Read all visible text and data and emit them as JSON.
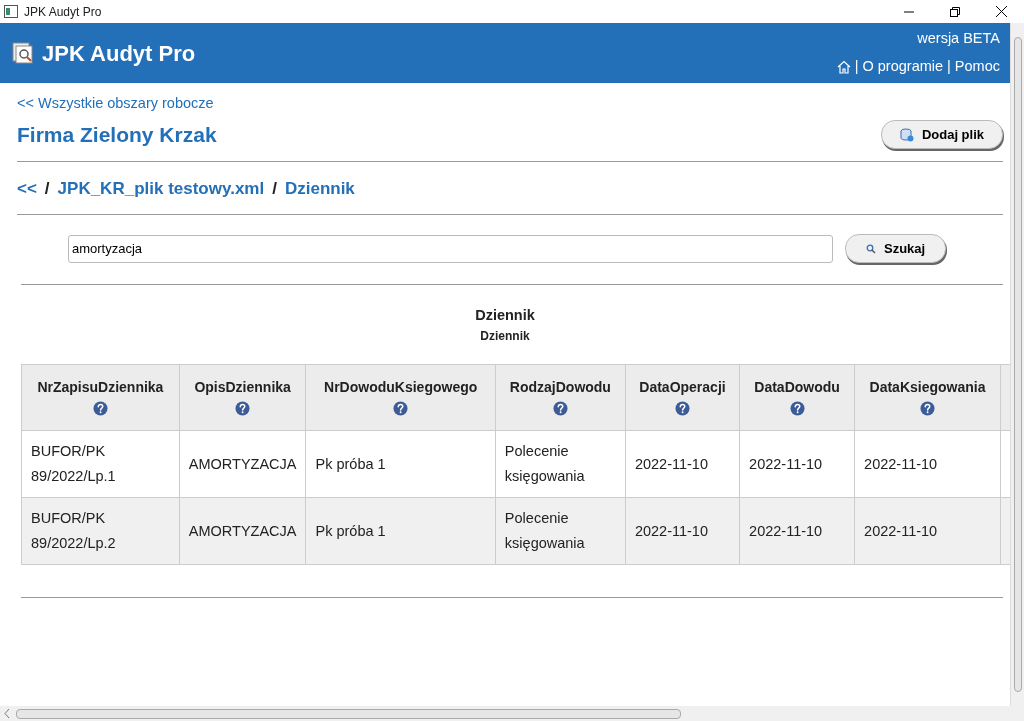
{
  "window": {
    "title": "JPK Audyt Pro"
  },
  "header": {
    "title": "JPK Audyt Pro",
    "version": "wersja BETA",
    "links": [
      "|",
      "O programie",
      "|",
      "Pomoc"
    ]
  },
  "back_link": "<< Wszystkie obszary robocze",
  "company": "Firma Zielony Krzak",
  "add_button": "Dodaj plik",
  "breadcrumb": [
    {
      "text": "<<",
      "kind": "link"
    },
    {
      "text": "/",
      "kind": "sep"
    },
    {
      "text": "JPK_KR_plik testowy.xml",
      "kind": "link"
    },
    {
      "text": "/",
      "kind": "sep"
    },
    {
      "text": "Dziennik",
      "kind": "link"
    }
  ],
  "search": {
    "value": "amortyzacja",
    "button": "Szukaj"
  },
  "table": {
    "title": "Dziennik",
    "subtitle": "Dziennik",
    "columns": [
      "NrZapisuDziennika",
      "OpisDziennika",
      "NrDowoduKsiegowego",
      "RodzajDowodu",
      "DataOperacji",
      "DataDowodu",
      "DataKsiegowania"
    ],
    "rows": [
      [
        "BUFOR/PK 89/2022/Lp.1",
        "AMORTYZACJA",
        "Pk próba 1",
        "Polecenie księgowania",
        "2022-11-10",
        "2022-11-10",
        "2022-11-10"
      ],
      [
        "BUFOR/PK 89/2022/Lp.2",
        "AMORTYZACJA",
        "Pk próba 1",
        "Polecenie księgowania",
        "2022-11-10",
        "2022-11-10",
        "2022-11-10"
      ]
    ]
  }
}
